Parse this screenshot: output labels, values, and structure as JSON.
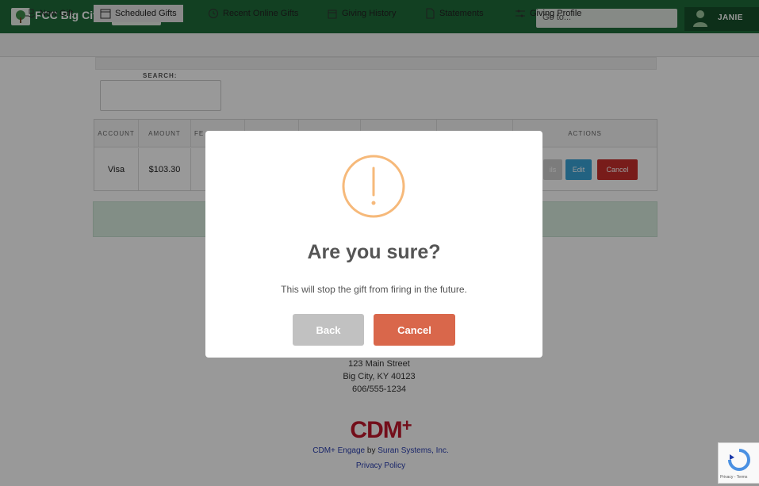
{
  "header": {
    "app_title": "FCC Big City",
    "section_pill": "Giving",
    "goto_placeholder": "Go to...",
    "user_name": "JANIE",
    "brand_color": "#1f6b3a"
  },
  "nav": {
    "items": [
      {
        "label": "New Gift",
        "icon": "gift-hand-icon"
      },
      {
        "label": "Scheduled Gifts",
        "icon": "calendar-icon"
      },
      {
        "label": "Recent Online Gifts",
        "icon": "history-icon"
      },
      {
        "label": "Giving History",
        "icon": "box-icon"
      },
      {
        "label": "Statements",
        "icon": "document-icon"
      },
      {
        "label": "Giving Profile",
        "icon": "sliders-icon"
      }
    ]
  },
  "search": {
    "label": "SEARCH:"
  },
  "table": {
    "headers": [
      "ACCOUNT",
      "AMOUNT",
      "FE",
      "ACTIONS"
    ],
    "rows": [
      {
        "account": "Visa",
        "amount": "$103.30"
      }
    ],
    "actions": {
      "details": "ils",
      "edit": "Edit",
      "cancel": "Cancel"
    }
  },
  "footer": {
    "address_line1": "123 Main Street",
    "address_line2": "Big City, KY 40123",
    "phone": "606/555-1234",
    "logo_text": "CDM",
    "logo_plus": "+",
    "powered_product": "CDM+ Engage",
    "powered_by": "by",
    "powered_company": "Suran Systems, Inc.",
    "privacy": "Privacy Policy"
  },
  "modal": {
    "title": "Are you sure?",
    "message": "This will stop the gift from firing in the future.",
    "back_label": "Back",
    "cancel_label": "Cancel",
    "icon": "warning-icon",
    "icon_color": "#f6b97a"
  },
  "recaptcha": {
    "text": "Privacy - Terms"
  }
}
